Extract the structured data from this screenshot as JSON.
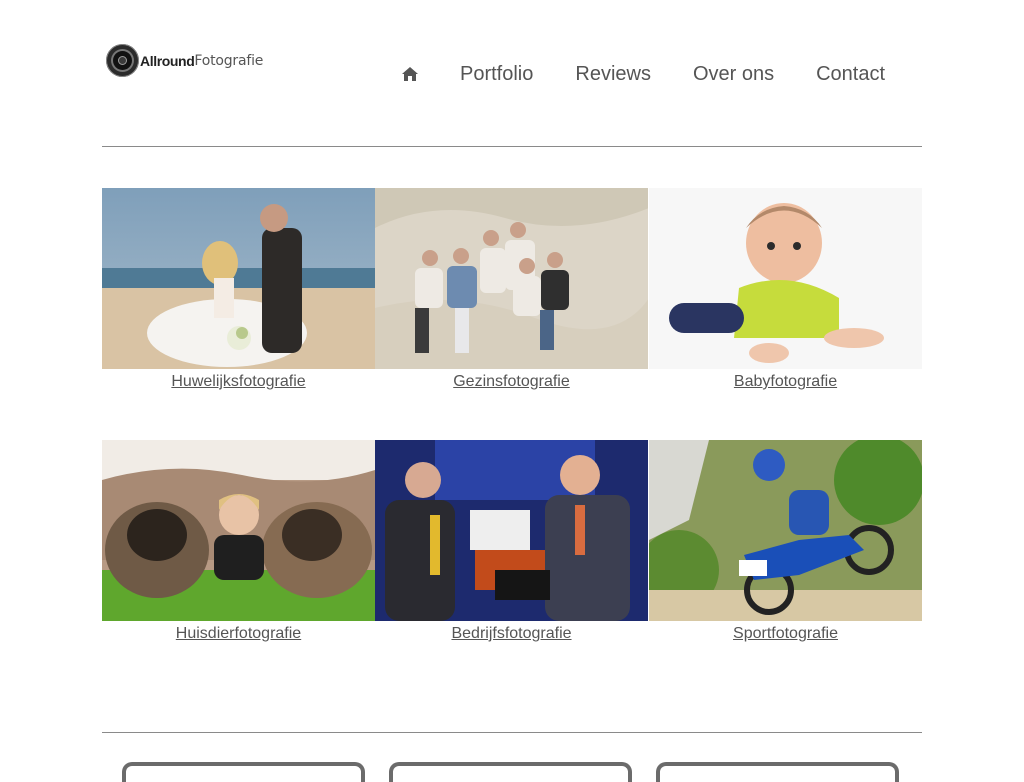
{
  "header": {
    "logo": {
      "bold": "Allround",
      "light": "Fotografie"
    },
    "nav": [
      {
        "label": "Portfolio"
      },
      {
        "label": "Reviews"
      },
      {
        "label": "Over ons"
      },
      {
        "label": "Contact"
      }
    ]
  },
  "gallery": [
    {
      "caption": "Huwelijksfotografie"
    },
    {
      "caption": "Gezinsfotografie"
    },
    {
      "caption": "Babyfotografie"
    },
    {
      "caption": "Huisdierfotografie"
    },
    {
      "caption": "Bedrijfsfotografie"
    },
    {
      "caption": "Sportfotografie"
    }
  ],
  "colors": {
    "text": "#555555",
    "divider": "#8a8a8a",
    "accent": "#6b6b6b"
  }
}
